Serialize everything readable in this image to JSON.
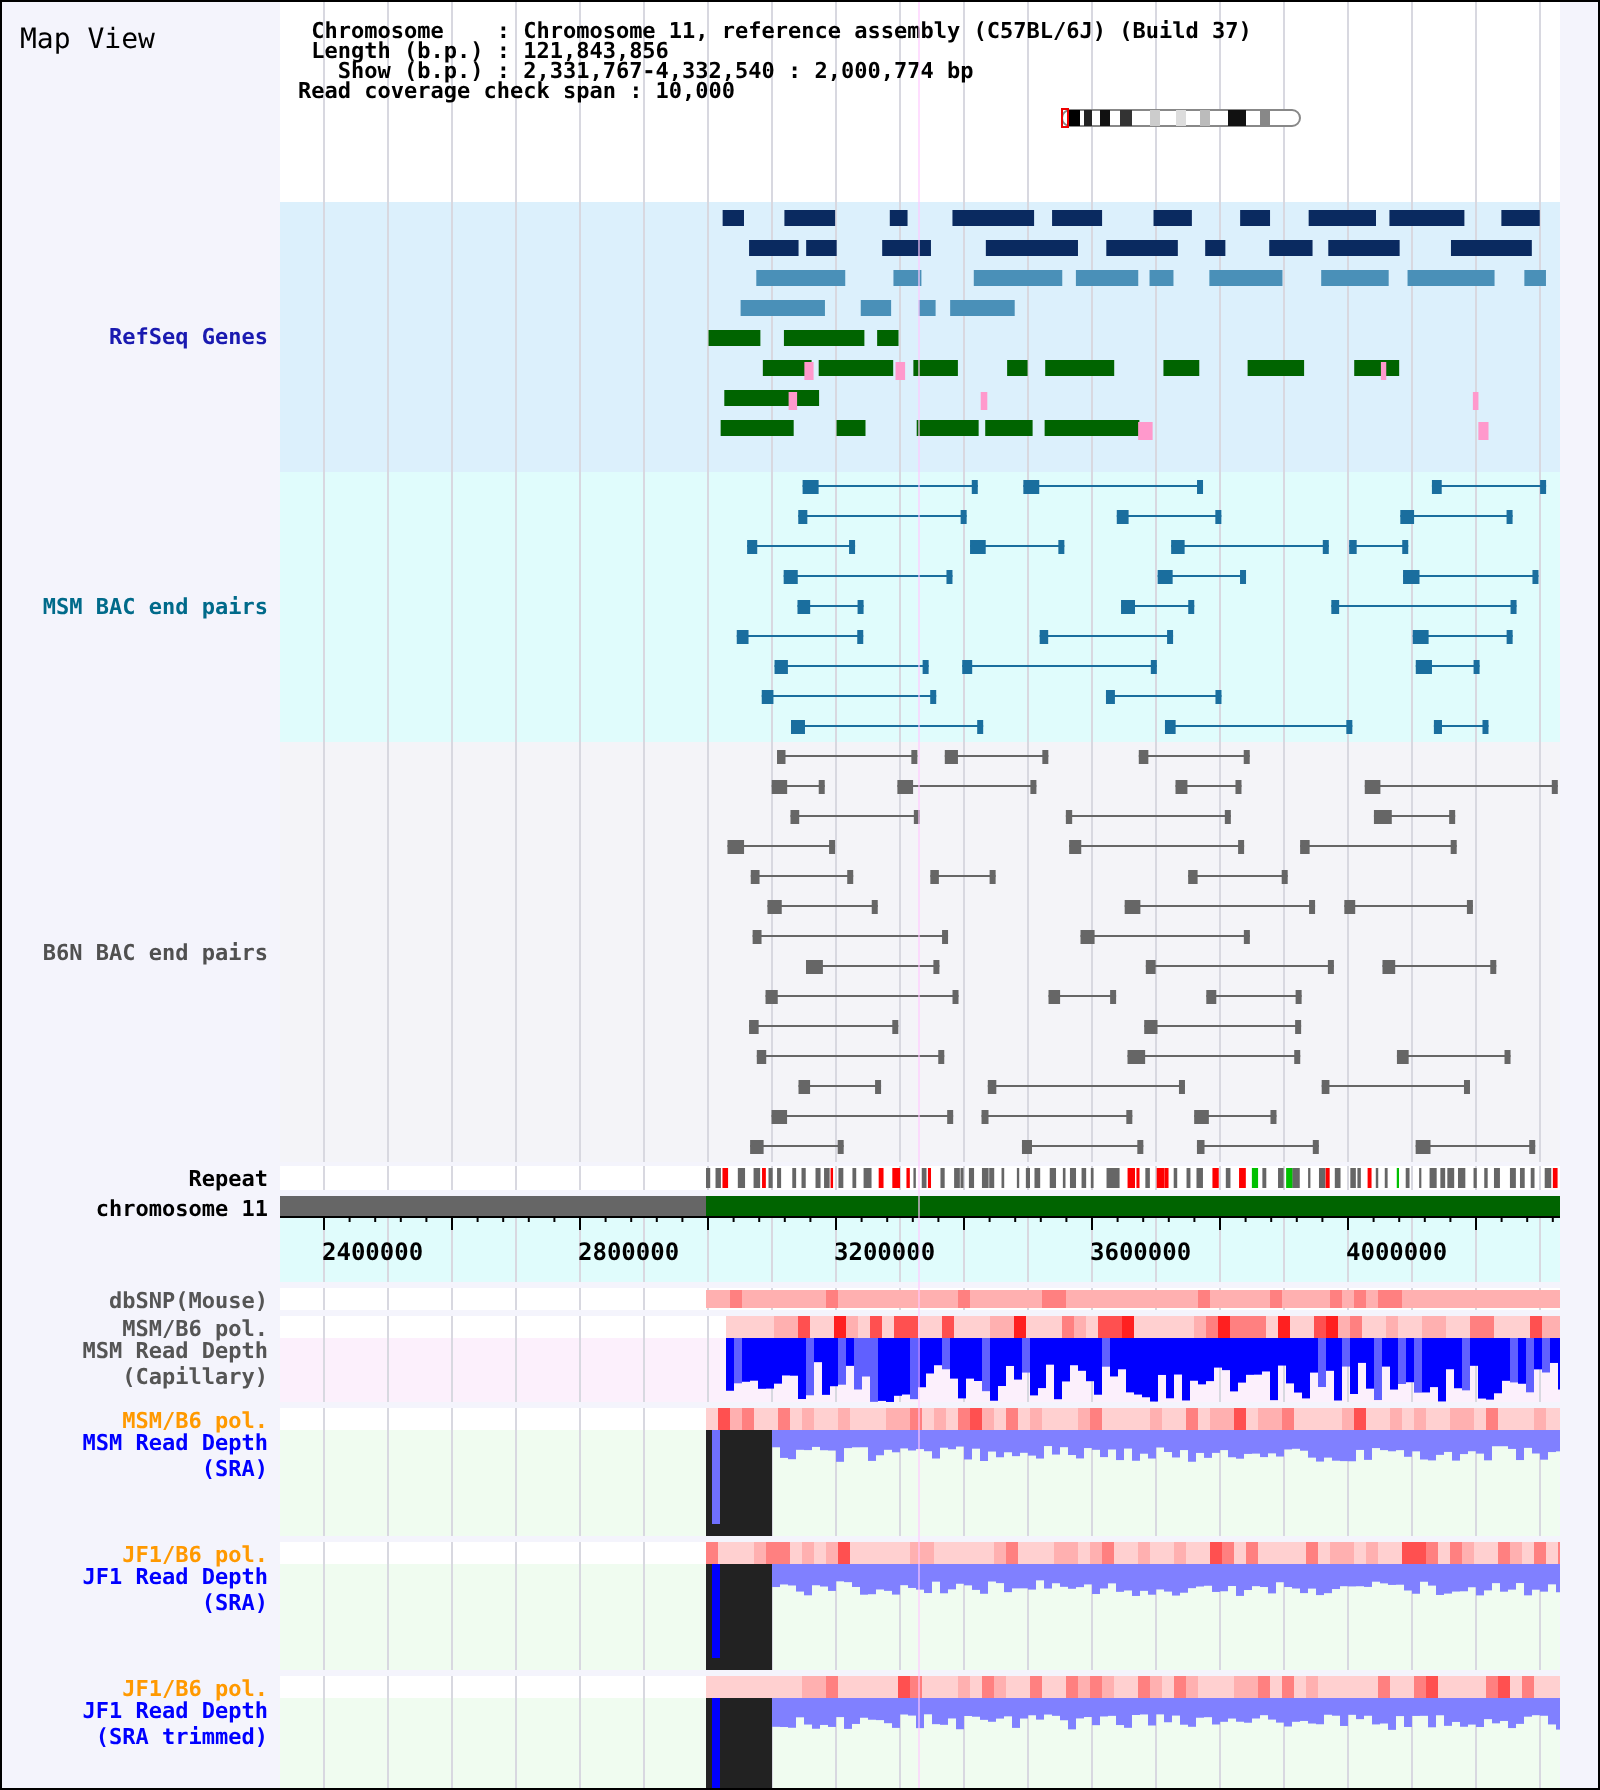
{
  "panel": {
    "title": "Map View"
  },
  "header": {
    "lines": [
      " Chromosome    : Chromosome 11, reference assembly (C57BL/6J) (Build 37)",
      " Length (b.p.) : 121,843,856",
      "   Show (b.p.) : 2,331,767-4,332,540 : 2,000,774 bp",
      "Read coverage check span : 10,000"
    ]
  },
  "tracks": [
    {
      "kind": "genes",
      "label": [
        "RefSeq Genes"
      ],
      "color": "#1a1ab0"
    },
    {
      "kind": "bac_pairs",
      "label": [
        "MSM BAC end pairs"
      ],
      "color": "#006a8a"
    },
    {
      "kind": "bac_pairs_b6n",
      "label": [
        "B6N BAC end pairs"
      ],
      "color": "#505050"
    },
    {
      "kind": "repeat",
      "label": [
        "Repeat"
      ],
      "color": "#000000"
    },
    {
      "kind": "chromosome",
      "label": [
        "chromosome 11"
      ],
      "color": "#000000"
    },
    {
      "kind": "axis",
      "ticks": [
        "2400000",
        "2800000",
        "3200000",
        "3600000",
        "4000000"
      ]
    },
    {
      "kind": "snp",
      "label": [
        "dbSNP(Mouse)"
      ],
      "color": "#555555"
    },
    {
      "kind": "polymorphism",
      "label": [
        "MSM/B6 pol."
      ],
      "color": "#555555"
    },
    {
      "kind": "depth_capillary",
      "label": [
        "MSM Read Depth",
        "(Capillary)"
      ],
      "color": "#555555"
    },
    {
      "kind": "polymorphism",
      "label": [
        "MSM/B6 pol."
      ],
      "color": "#ff9900"
    },
    {
      "kind": "depth_sra",
      "label": [
        "MSM Read Depth",
        "(SRA)"
      ],
      "color": "#0000ff"
    },
    {
      "kind": "polymorphism",
      "label": [
        "JF1/B6 pol."
      ],
      "color": "#ff9900"
    },
    {
      "kind": "depth_sra",
      "label": [
        "JF1 Read Depth",
        "(SRA)"
      ],
      "color": "#0000ff"
    },
    {
      "kind": "polymorphism",
      "label": [
        "JF1/B6 pol."
      ],
      "color": "#ff9900"
    },
    {
      "kind": "depth_sra",
      "label": [
        "JF1 Read Depth",
        "(SRA trimmed)"
      ],
      "color": "#0000ff"
    }
  ]
}
